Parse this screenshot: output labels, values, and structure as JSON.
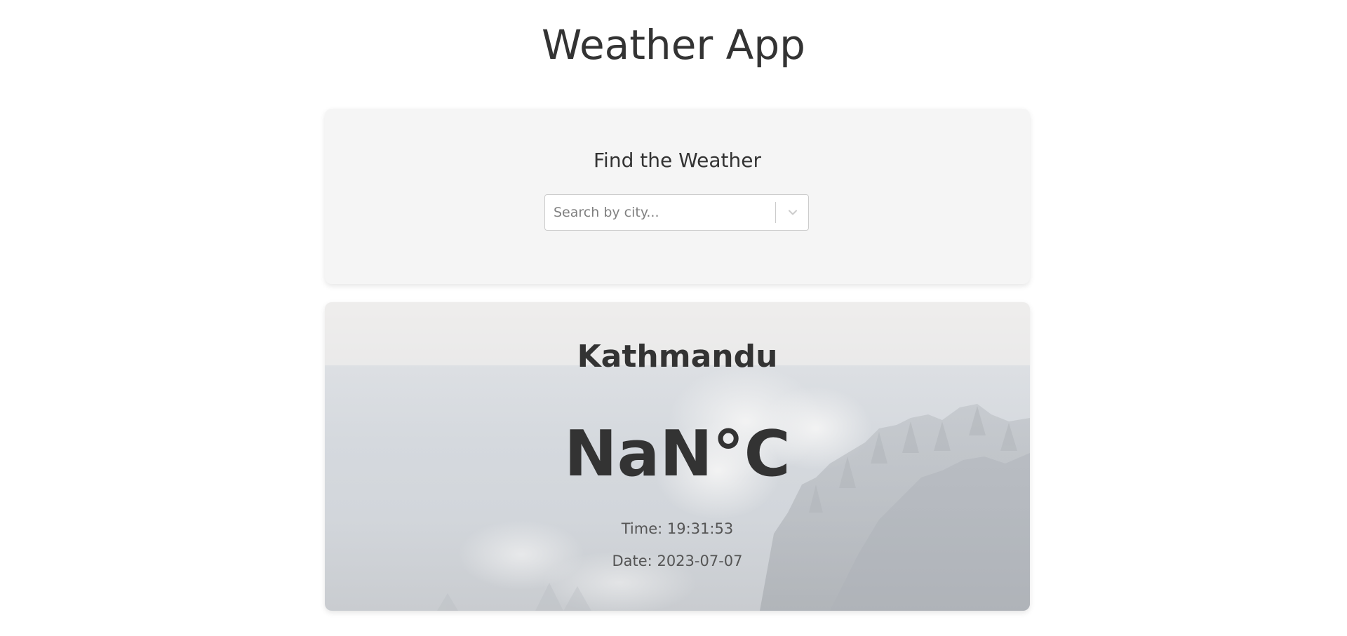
{
  "app": {
    "title": "Weather App"
  },
  "search": {
    "heading": "Find the Weather",
    "placeholder": "Search by city...",
    "value": "",
    "dropdown_icon": "chevron-down-icon"
  },
  "weather": {
    "city": "Kathmandu",
    "temperature": "NaN°C",
    "time_label": "Time:",
    "time_value": "19:31:53",
    "date_label": "Date:",
    "date_value": "2023-07-07",
    "background": "snowy-forest-fog-image"
  },
  "colors": {
    "page_background": "#ffffff",
    "card_background": "#f5f5f5",
    "text_primary": "#333333",
    "text_secondary": "#555555",
    "input_border": "#cccccc",
    "placeholder": "#808080"
  }
}
